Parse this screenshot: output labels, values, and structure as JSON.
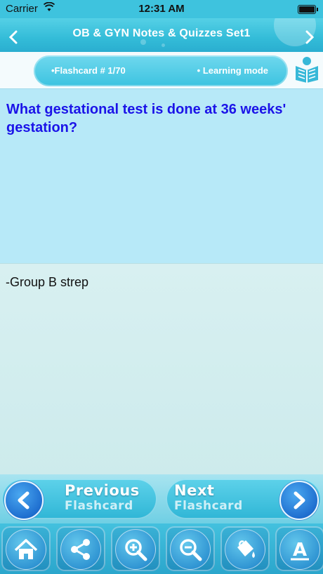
{
  "status_bar": {
    "carrier": "Carrier",
    "time": "12:31 AM"
  },
  "navbar": {
    "title": "OB & GYN Notes & Quizzes  Set1",
    "back_icon": "chevron-left-icon",
    "forward_icon": "chevron-right-icon"
  },
  "info_bar": {
    "flashcard_count": "•Flashcard #  1/70",
    "mode": "• Learning mode",
    "mode_icon": "book-icon"
  },
  "card": {
    "question": "What gestational test is done at 36 weeks' gestation?",
    "answer": "-Group B strep"
  },
  "nav_buttons": {
    "previous": {
      "line1": "Previous",
      "line2": "Flashcard"
    },
    "next": {
      "line1": "Next",
      "line2": "Flashcard"
    }
  },
  "toolbar": {
    "icons": [
      "home-icon",
      "share-icon",
      "zoom-in-icon",
      "zoom-out-icon",
      "paint-bucket-icon",
      "font-icon"
    ],
    "font_letter": "A"
  },
  "colors": {
    "accent": "#3ec3de",
    "question_text": "#1b13e8",
    "question_bg": "#b7e9f8",
    "answer_bg": "#d8f0f1"
  }
}
